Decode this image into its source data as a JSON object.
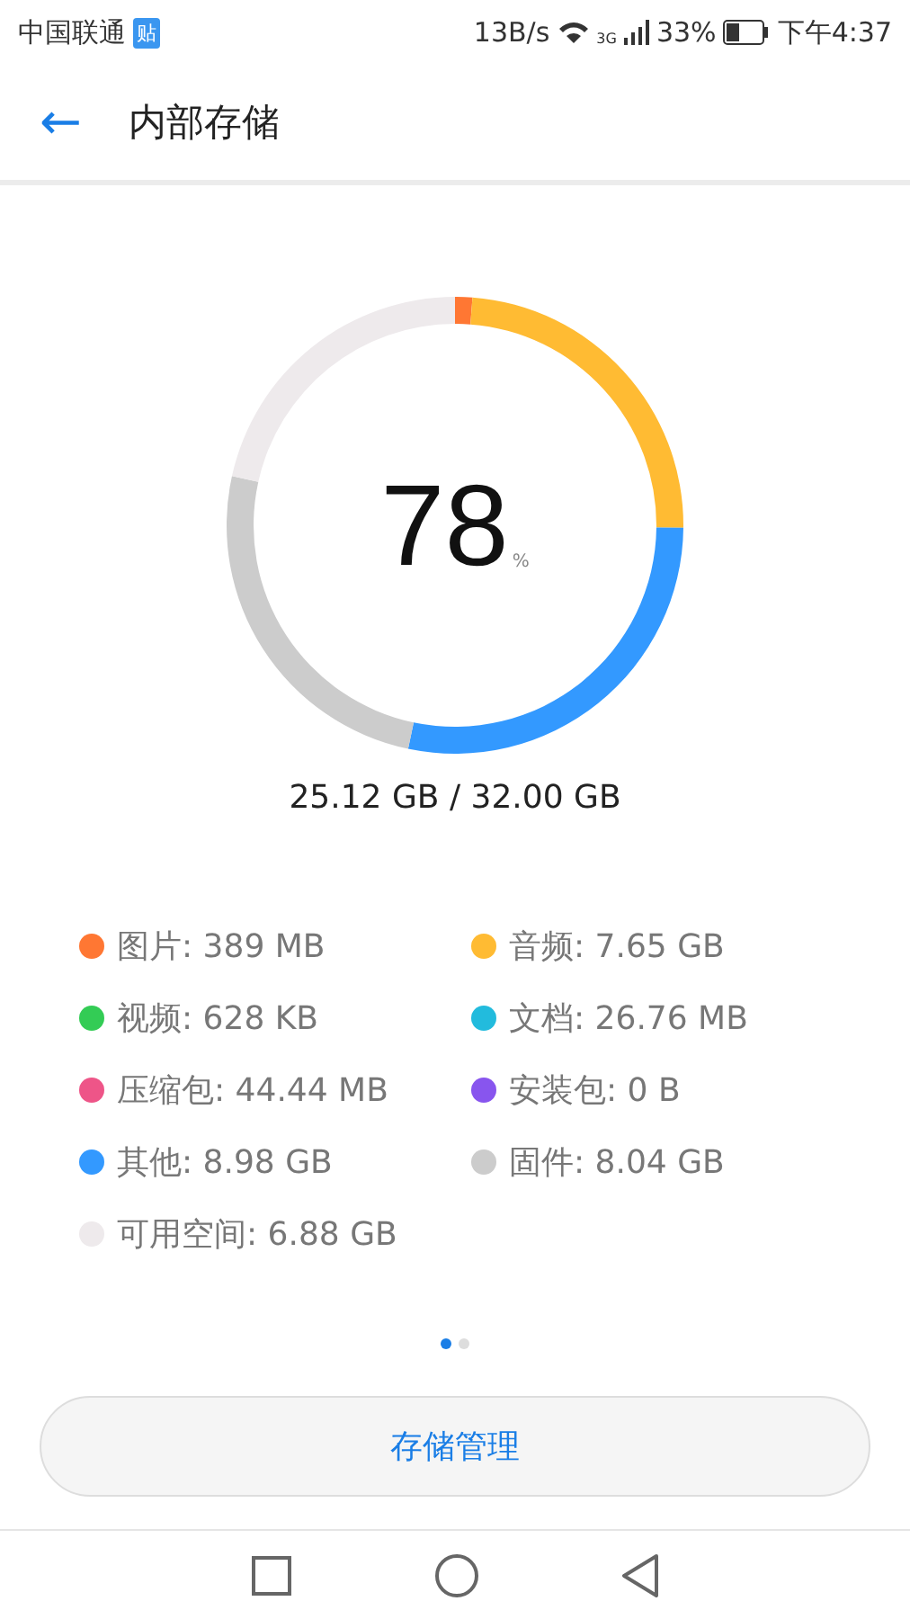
{
  "status_bar": {
    "carrier": "中国联通",
    "carrier_badge": "贴",
    "speed": "13B/s",
    "network": "3G",
    "battery": "33%",
    "time": "下午4:37"
  },
  "header": {
    "back": "←",
    "title": "内部存储"
  },
  "storage": {
    "percent": "78",
    "percent_unit": "%",
    "total": "25.12 GB / 32.00 GB",
    "chart_data": {
      "type": "donut",
      "values": [
        1.22,
        23.95,
        28.12,
        25.17,
        21.54
      ],
      "colors": [
        "#ff7733",
        "#ffbb33",
        "#3399ff",
        "#cccccc",
        "#eeeaec"
      ]
    }
  },
  "legend": [
    {
      "label": "图片: 389 MB",
      "color": "#ff7733"
    },
    {
      "label": "音频: 7.65 GB",
      "color": "#ffbb33"
    },
    {
      "label": "视频: 628 KB",
      "color": "#33cc55"
    },
    {
      "label": "文档: 26.76 MB",
      "color": "#22bbdd"
    },
    {
      "label": "压缩包: 44.44 MB",
      "color": "#ee5588"
    },
    {
      "label": "安装包: 0 B",
      "color": "#8855ee"
    },
    {
      "label": "其他: 8.98 GB",
      "color": "#3399ff"
    },
    {
      "label": "固件: 8.04 GB",
      "color": "#cccccc"
    },
    {
      "label": "可用空间: 6.88 GB",
      "color": "#eeeaec"
    }
  ],
  "pager": [
    {
      "selected": true
    },
    {
      "selected": false
    }
  ],
  "manage_button": "存储管理"
}
